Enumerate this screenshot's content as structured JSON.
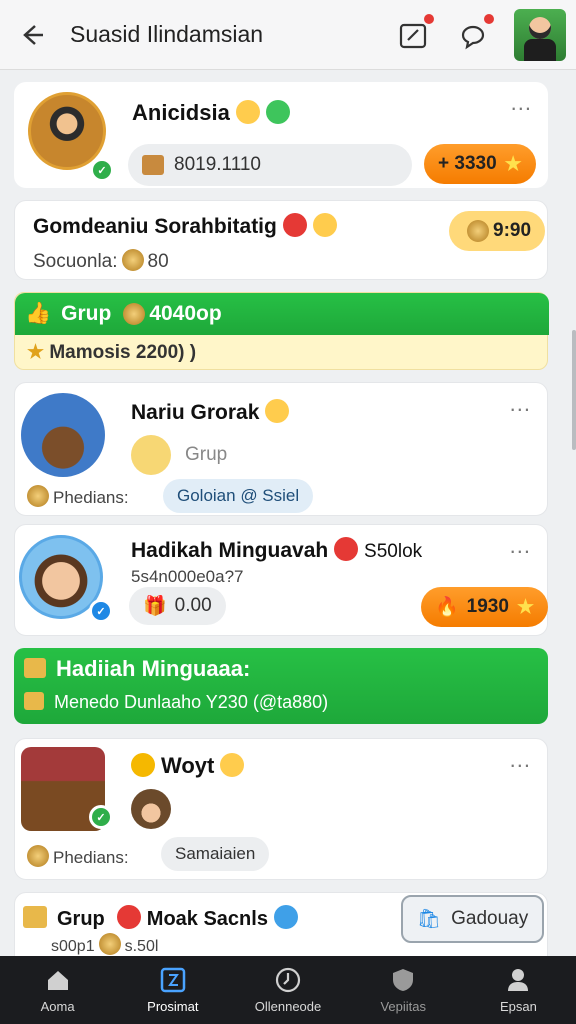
{
  "header": {
    "title": "Suasid Ilindamsian",
    "back_icon": "back-arrow-icon",
    "icons": [
      "notification-box-icon",
      "chat-bubble-icon"
    ]
  },
  "cards": {
    "profile": {
      "name": "Anicidsia",
      "wallet": "8019.1110",
      "points": "+ 3330"
    },
    "summary": {
      "title": "Gomdeaniu Sorahbitatig",
      "subtitle_label": "Socuonla:",
      "subtitle_value": "80",
      "score": "9:90"
    },
    "group_banner": {
      "title": "Grup",
      "title_extra": "4040op",
      "note": "Mamosis 2200)  )"
    },
    "nariu": {
      "name": "Nariu Grorak",
      "group_label": "Grup",
      "label": "Phedians:",
      "tag": "Goloian @ Ssiel"
    },
    "hadikah": {
      "name": "Hadikah Minguavah",
      "extra": "S50lok",
      "code": "5s4n000e0a?7",
      "value": "0.00",
      "points": "1930"
    },
    "weekly_banner": {
      "title": "Hadiiah Minguaaa:",
      "note": "Menedo Dunlaaho Y230 (@ta880)"
    },
    "woyt": {
      "name": "Woyt",
      "label": "Phedians:",
      "tag": "Samaiaien"
    },
    "grup_bottom": {
      "title": "Grup",
      "name": "Moak Sacnls",
      "code": "s00p1",
      "value": "s.50l",
      "button": "Gadouay"
    }
  },
  "nav": {
    "items": [
      {
        "label": "Aoma",
        "icon": "home-icon"
      },
      {
        "label": "Prosimat",
        "icon": "square-badge-icon"
      },
      {
        "label": "Ollenneode",
        "icon": "clock-icon"
      },
      {
        "label": "Vepiitas",
        "icon": "shield-icon"
      },
      {
        "label": "Epsan",
        "icon": "person-icon"
      }
    ],
    "active_index": 1
  },
  "colors": {
    "accent_orange": "#f57c00",
    "accent_green": "#1ea83a",
    "nav_bg": "#1b1c1f"
  }
}
